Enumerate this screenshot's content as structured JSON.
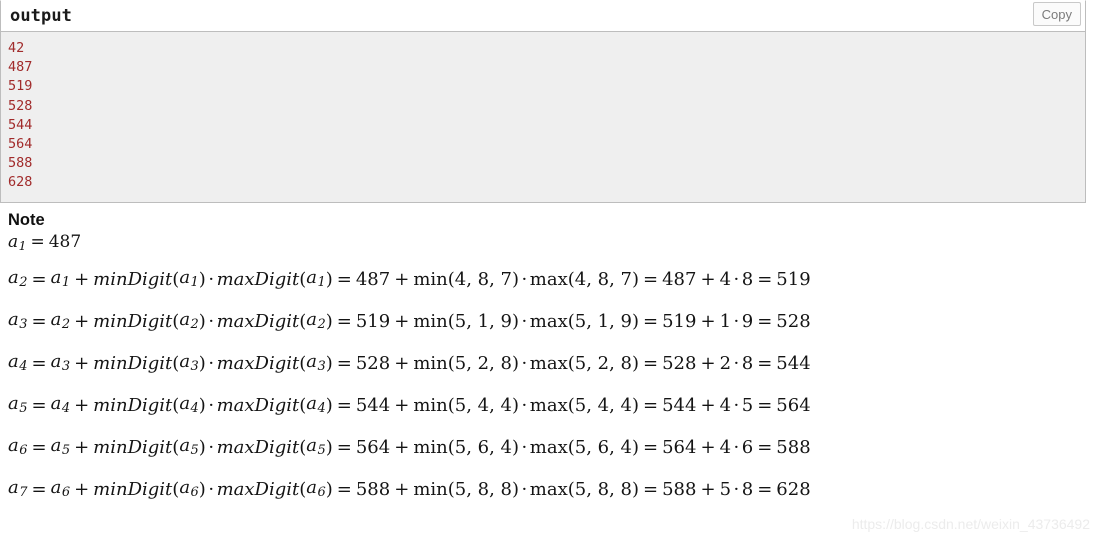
{
  "code_block": {
    "title": "output",
    "copy_label": "Copy",
    "text_color": "#a12b2b",
    "background": "#efefef",
    "border_color": "#bdbdbd",
    "lines": [
      "42",
      "487",
      "519",
      "528",
      "544",
      "564",
      "588",
      "628"
    ]
  },
  "note": {
    "heading": "Note",
    "first_line": {
      "lhs_var": "a",
      "lhs_sub": "1",
      "eq": "=",
      "value": "487"
    },
    "equations": [
      {
        "lhs": "a",
        "lhs_sub": "2",
        "prev": "a",
        "prev_sub": "1",
        "min_fn": "minDigit",
        "max_fn": "maxDigit",
        "prev_value": "487",
        "digits": "4, 8, 7",
        "min_value": "4",
        "max_value": "8",
        "result": "519",
        "plain": "a_2 = a_1 + minDigit(a_1) · maxDigit(a_1) = 487 + min(4, 8, 7) · max(4, 8, 7) = 487 + 4 · 8 = 519"
      },
      {
        "lhs": "a",
        "lhs_sub": "3",
        "prev": "a",
        "prev_sub": "2",
        "min_fn": "minDigit",
        "max_fn": "maxDigit",
        "prev_value": "519",
        "digits": "5, 1, 9",
        "min_value": "1",
        "max_value": "9",
        "result": "528",
        "plain": "a_3 = a_2 + minDigit(a_2) · maxDigit(a_2) = 519 + min(5, 1, 9) · max(5, 1, 9) = 519 + 1 · 9 = 528"
      },
      {
        "lhs": "a",
        "lhs_sub": "4",
        "prev": "a",
        "prev_sub": "3",
        "min_fn": "minDigit",
        "max_fn": "maxDigit",
        "prev_value": "528",
        "digits": "5, 2, 8",
        "min_value": "2",
        "max_value": "8",
        "result": "544",
        "plain": "a_4 = a_3 + minDigit(a_3) · maxDigit(a_3) = 528 + min(5, 2, 8) · max(5, 2, 8) = 528 + 2 · 8 = 544"
      },
      {
        "lhs": "a",
        "lhs_sub": "5",
        "prev": "a",
        "prev_sub": "4",
        "min_fn": "minDigit",
        "max_fn": "maxDigit",
        "prev_value": "544",
        "digits": "5, 4, 4",
        "min_value": "4",
        "max_value": "5",
        "result": "564",
        "plain": "a_5 = a_4 + minDigit(a_4) · maxDigit(a_4) = 544 + min(5, 4, 4) · max(5, 4, 4) = 544 + 4 · 5 = 564"
      },
      {
        "lhs": "a",
        "lhs_sub": "6",
        "prev": "a",
        "prev_sub": "5",
        "min_fn": "minDigit",
        "max_fn": "maxDigit",
        "prev_value": "564",
        "digits": "5, 6, 4",
        "min_value": "4",
        "max_value": "6",
        "result": "588",
        "plain": "a_6 = a_5 + minDigit(a_5) · maxDigit(a_5) = 564 + min(5, 6, 4) · max(5, 6, 4) = 564 + 4 · 6 = 588"
      },
      {
        "lhs": "a",
        "lhs_sub": "7",
        "prev": "a",
        "prev_sub": "6",
        "min_fn": "minDigit",
        "max_fn": "maxDigit",
        "prev_value": "588",
        "digits": "5, 8, 8",
        "min_value": "5",
        "max_value": "8",
        "result": "628",
        "plain": "a_7 = a_6 + minDigit(a_6) · maxDigit(a_6) = 588 + min(5, 8, 8) · max(5, 8, 8) = 588 + 5 · 8 = 628"
      }
    ],
    "symbols": {
      "equals": "=",
      "plus": "+",
      "cdot": "·",
      "lparen": "(",
      "rparen": ")",
      "min_label": "min",
      "max_label": "max"
    }
  },
  "watermark": {
    "text": "https://blog.csdn.net/weixin_43736492"
  }
}
